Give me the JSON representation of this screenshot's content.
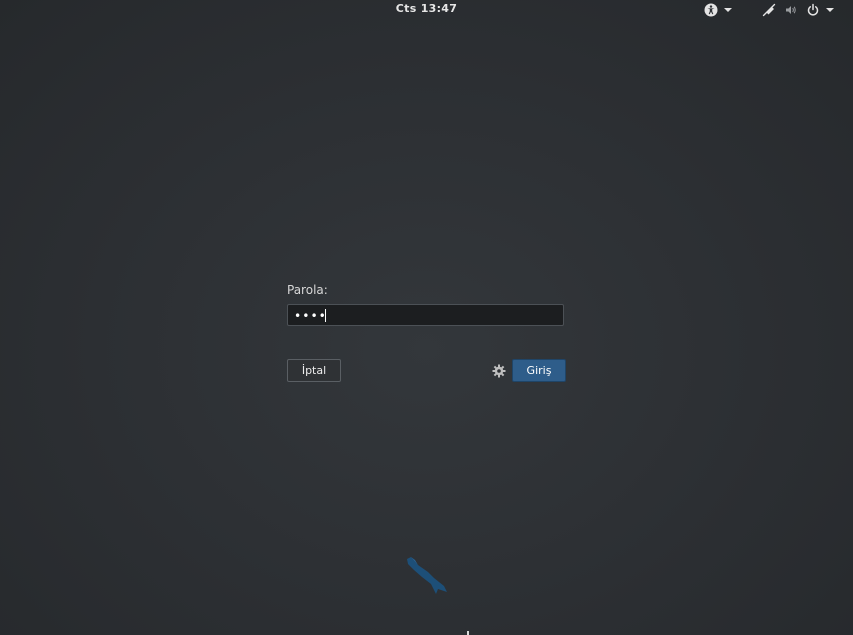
{
  "top_bar": {
    "clock": "Cts 13:47",
    "icons": [
      "accessibility-icon",
      "network-icon",
      "volume-icon",
      "power-icon"
    ]
  },
  "login": {
    "label": "Parola:",
    "password_value": "••••",
    "cancel_label": "İptal",
    "login_label": "Giriş"
  },
  "colors": {
    "background": "#2c2f33",
    "accent": "#2e5d8a",
    "logo": "#1d4f78"
  }
}
